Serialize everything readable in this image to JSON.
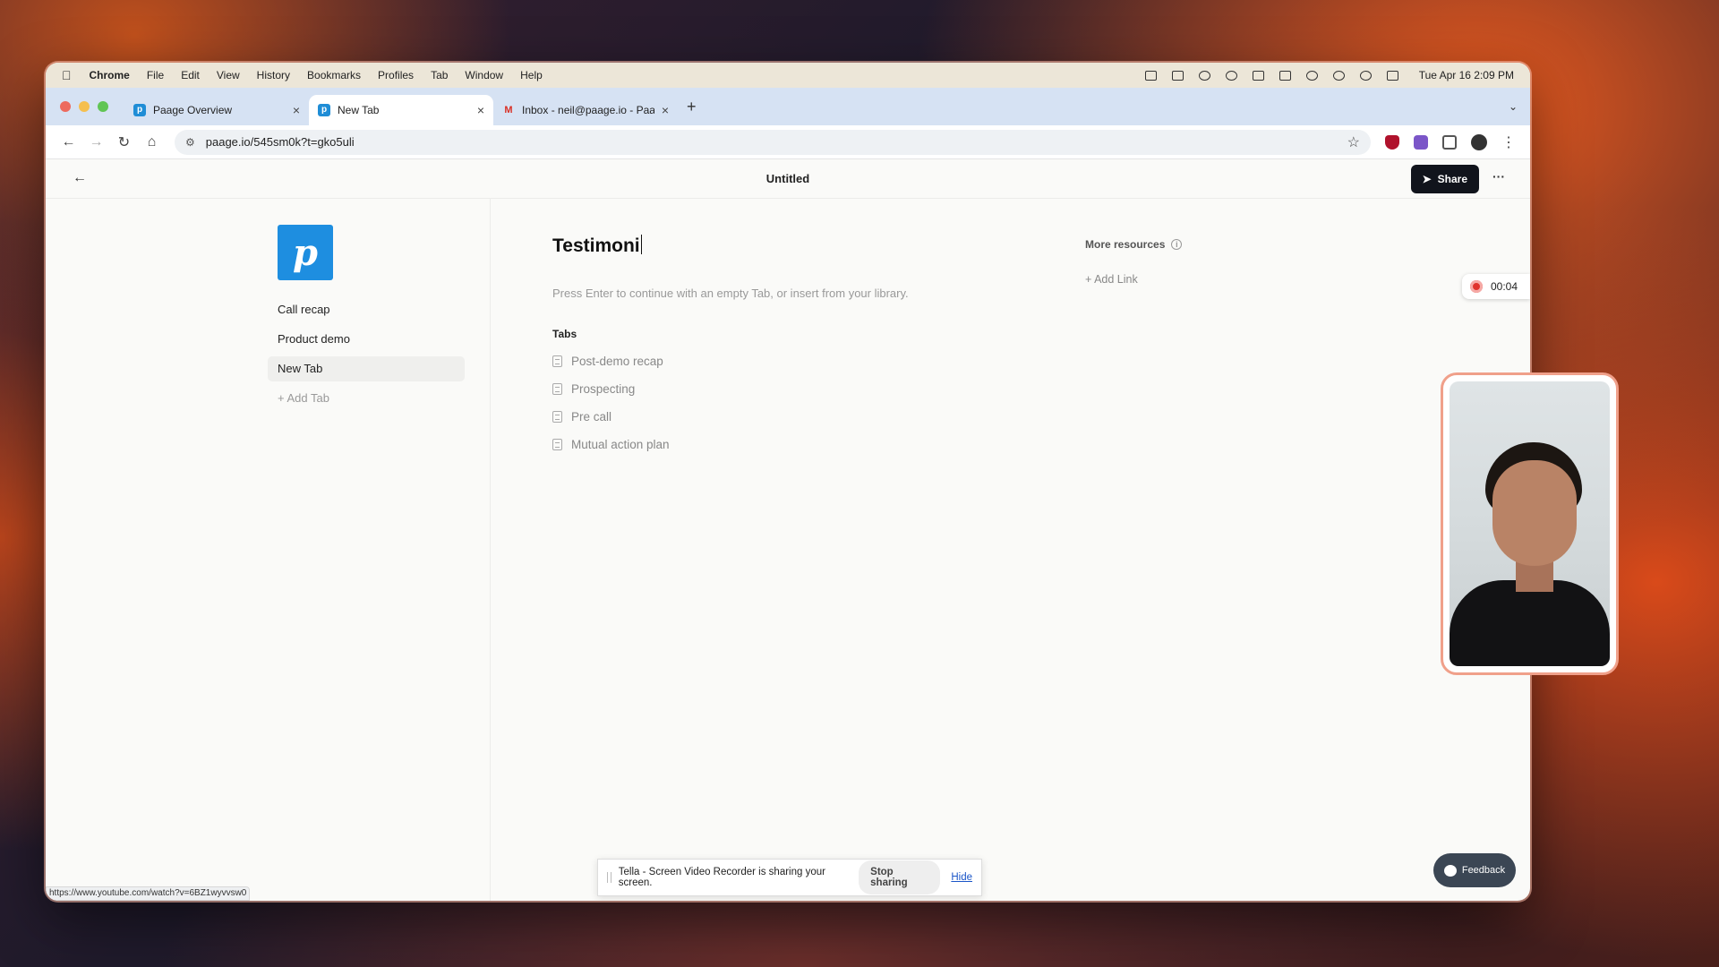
{
  "menubar": {
    "items": [
      "Chrome",
      "File",
      "Edit",
      "View",
      "History",
      "Bookmarks",
      "Profiles",
      "Tab",
      "Window",
      "Help"
    ],
    "datetime": "Tue Apr 16  2:09 PM"
  },
  "browser": {
    "tabs": [
      {
        "title": "Paage Overview",
        "favicon": "paage-icon"
      },
      {
        "title": "New Tab",
        "favicon": "paage-icon",
        "active": true
      },
      {
        "title": "Inbox - neil@paage.io - Paag",
        "favicon": "gmail-icon"
      }
    ],
    "url": "paage.io/545sm0k?t=gko5uli",
    "status_url": "https://www.youtube.com/watch?v=6BZ1wyvvsw0"
  },
  "app": {
    "doc_title": "Untitled",
    "share_label": "Share",
    "sidebar": {
      "items": [
        {
          "label": "Call recap"
        },
        {
          "label": "Product demo"
        },
        {
          "label": "New Tab",
          "active": true
        }
      ],
      "add_label": "Add Tab"
    },
    "main": {
      "title_input": "Testimoni",
      "hint": "Press Enter to continue with an empty Tab, or insert from your library.",
      "tabs_heading": "Tabs",
      "tabs": [
        "Post-demo recap",
        "Prospecting",
        "Pre call",
        "Mutual action plan"
      ]
    },
    "resources": {
      "heading": "More resources",
      "add_link_label": "Add Link"
    },
    "feedback_label": "Feedback"
  },
  "recorder": {
    "timer": "00:04",
    "share_message": "Tella - Screen Video Recorder is sharing your screen.",
    "stop_label": "Stop sharing",
    "hide_label": "Hide"
  },
  "colors": {
    "accent_dark": "#11141c",
    "logo_blue": "#1e8ee0",
    "record_red": "#e0332d"
  }
}
